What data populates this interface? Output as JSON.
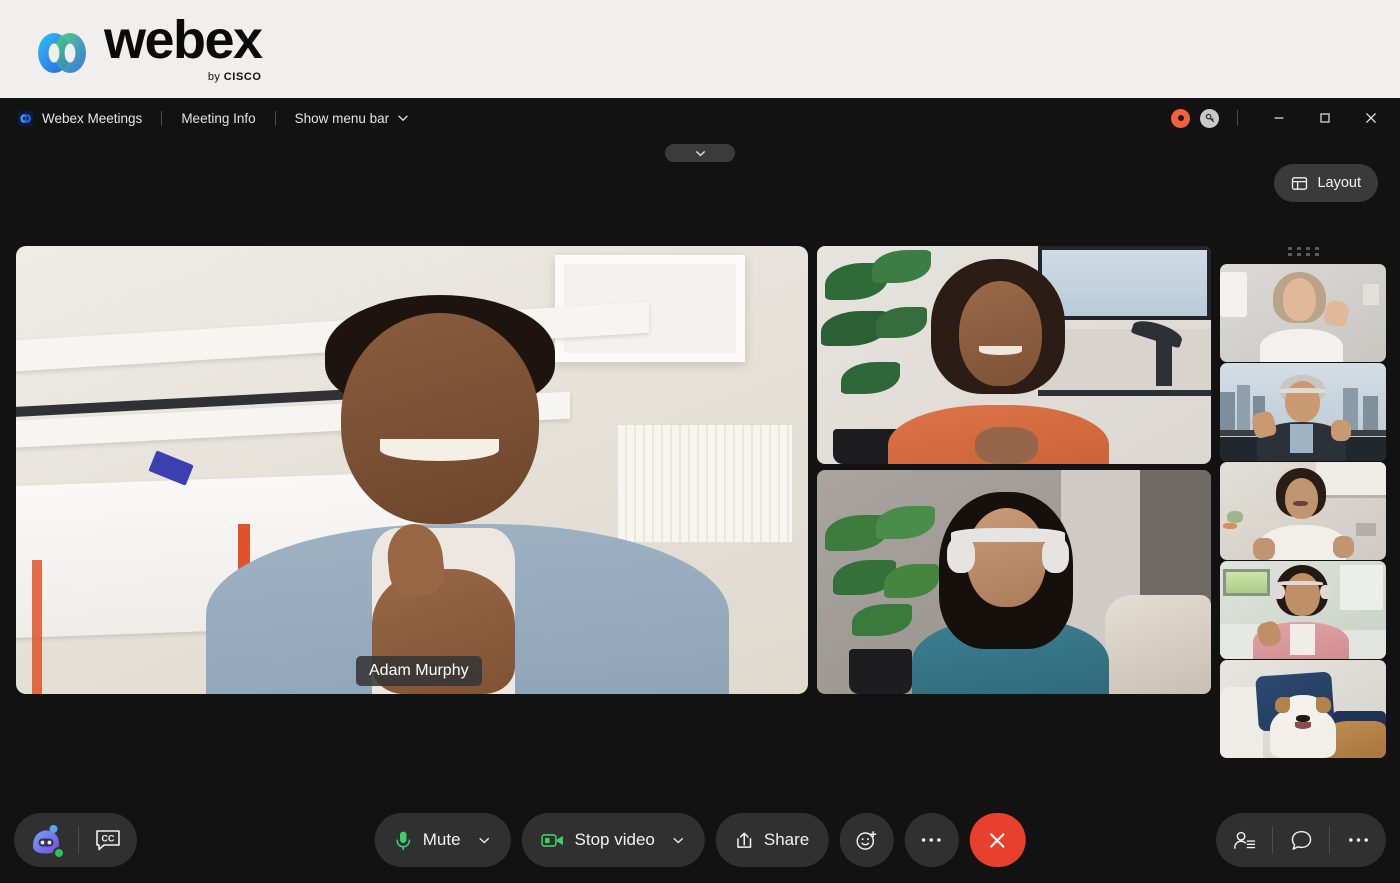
{
  "brand": {
    "wordmark": "webex",
    "byline_prefix": "by ",
    "byline_brand": "CISCO",
    "logo_icon": "webex-logo-icon"
  },
  "titlebar": {
    "app_icon": "webex-app-icon",
    "app_name": "Webex Meetings",
    "meeting_info_label": "Meeting Info",
    "show_menu_bar_label": "Show menu bar",
    "show_menu_bar_chevron": "chevron-down-icon",
    "recording_icon": "recording-indicator-icon",
    "encryption_icon": "key-icon",
    "minimize_icon": "minimize-icon",
    "maximize_icon": "maximize-icon",
    "close_icon": "close-icon",
    "colors": {
      "recording_red": "#f2603c",
      "key_badge_gray": "#c9c9c9",
      "bar_bg": "#121212"
    }
  },
  "stage": {
    "collapse_pill_icon": "chevron-down-icon",
    "layout_button": {
      "label": "Layout",
      "icon": "layout-grid-icon"
    },
    "filmstrip_handle_icon": "drag-handle-icon",
    "active_speaker": {
      "name": "Adam Murphy",
      "tile": "main-video-tile"
    },
    "side_tiles": [
      {
        "name": "participant-tile-2",
        "description": "woman in orange shirt at desk"
      },
      {
        "name": "participant-tile-3",
        "description": "woman with white headphones on couch"
      }
    ],
    "filmstrip_tiles": [
      {
        "name": "filmstrip-tile-1",
        "description": "woman waving in white blouse"
      },
      {
        "name": "filmstrip-tile-2",
        "description": "man with headphones waving, city view"
      },
      {
        "name": "filmstrip-tile-3",
        "description": "woman talking in kitchen"
      },
      {
        "name": "filmstrip-tile-4",
        "description": "woman with headphones thumbs up"
      },
      {
        "name": "filmstrip-tile-5",
        "description": "dog on couch with blue pillow"
      }
    ]
  },
  "controls": {
    "assistant": {
      "label": "AI Assistant",
      "icon": "ai-assistant-icon",
      "status": "online"
    },
    "captions": {
      "label": "CC",
      "icon": "closed-captions-icon"
    },
    "mute": {
      "label": "Mute",
      "icon": "microphone-icon",
      "chevron": "chevron-down-icon",
      "icon_color": "#3bcf6e"
    },
    "video": {
      "label": "Stop video",
      "icon": "camera-icon",
      "chevron": "chevron-down-icon",
      "icon_color": "#3bcf6e"
    },
    "share": {
      "label": "Share",
      "icon": "share-upload-icon"
    },
    "reactions": {
      "label": "Reactions",
      "icon": "smiley-plus-icon"
    },
    "more_center": {
      "label": "More options",
      "icon": "ellipsis-icon"
    },
    "end_call": {
      "label": "End meeting",
      "icon": "close-icon",
      "color": "#e8402c"
    },
    "participants": {
      "label": "Participants",
      "icon": "participants-icon"
    },
    "chat": {
      "label": "Chat",
      "icon": "chat-bubble-icon"
    },
    "more_right": {
      "label": "More",
      "icon": "ellipsis-icon"
    }
  }
}
